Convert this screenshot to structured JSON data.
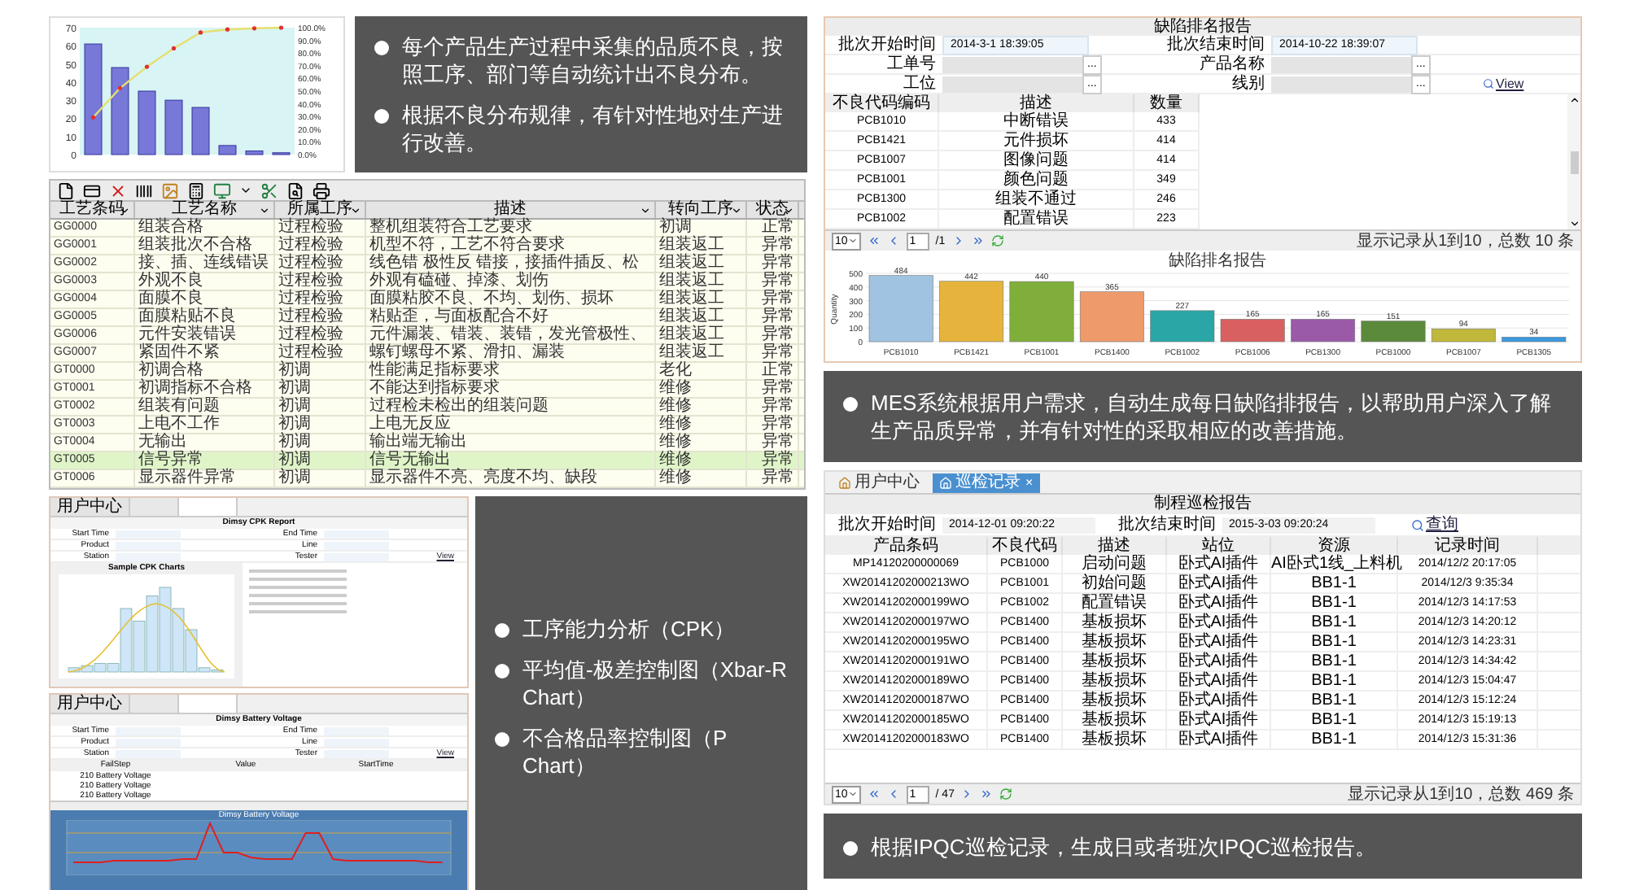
{
  "pareto_chart": {
    "left_axis_labels": [
      "70",
      "60",
      "50",
      "40",
      "30",
      "20",
      "10",
      "0"
    ],
    "right_axis_labels": [
      "100.0%",
      "90.0%",
      "80.0%",
      "70.0%",
      "60.0%",
      "50.0%",
      "40.0%",
      "30.0%",
      "20.0%",
      "10.0%",
      "0.0%"
    ]
  },
  "notes_top_left": [
    "每个产品生产过程中采集的品质不良，按照工序、部门等自动统计出不良分布。",
    "根据不良分布规律，有针对性地对生产进行改善。"
  ],
  "process_table": {
    "columns": [
      "工艺条码",
      "工艺名称",
      "所属工序",
      "描述",
      "转向工序",
      "状态"
    ],
    "rows": [
      {
        "cells": [
          "GG0000",
          "组装合格",
          "过程检验",
          "整机组装符合工艺要求",
          "初调",
          "正常"
        ],
        "selected": false
      },
      {
        "cells": [
          "GG0001",
          "组装批次不合格",
          "过程检验",
          "机型不符，工艺不符合要求",
          "组装返工",
          "异常"
        ],
        "selected": false
      },
      {
        "cells": [
          "GG0002",
          "接、插、连线错误",
          "过程检验",
          "线色错 极性反 错接，接插件插反、松",
          "组装返工",
          "异常"
        ],
        "selected": false
      },
      {
        "cells": [
          "GG0003",
          "外观不良",
          "过程检验",
          "外观有磕碰、掉漆、划伤",
          "组装返工",
          "异常"
        ],
        "selected": false
      },
      {
        "cells": [
          "GG0004",
          "面膜不良",
          "过程检验",
          "面膜粘胶不良、不均、划伤、损坏",
          "组装返工",
          "异常"
        ],
        "selected": false
      },
      {
        "cells": [
          "GG0005",
          "面膜粘贴不良",
          "过程检验",
          "粘贴歪，与面板配合不好",
          "组装返工",
          "异常"
        ],
        "selected": false
      },
      {
        "cells": [
          "GG0006",
          "元件安装错误",
          "过程检验",
          "元件漏装、错装、装错，发光管极性、",
          "组装返工",
          "异常"
        ],
        "selected": false
      },
      {
        "cells": [
          "GG0007",
          "紧固件不紧",
          "过程检验",
          "螺钉螺母不紧、滑扣、漏装",
          "组装返工",
          "异常"
        ],
        "selected": false
      },
      {
        "cells": [
          "GT0000",
          "初调合格",
          "初调",
          "性能满足指标要求",
          "老化",
          "正常"
        ],
        "selected": false
      },
      {
        "cells": [
          "GT0001",
          "初调指标不合格",
          "初调",
          "不能达到指标要求",
          "维修",
          "异常"
        ],
        "selected": false
      },
      {
        "cells": [
          "GT0002",
          "组装有问题",
          "初调",
          "过程检未检出的组装问题",
          "维修",
          "异常"
        ],
        "selected": false
      },
      {
        "cells": [
          "GT0003",
          "上电不工作",
          "初调",
          "上电无反应",
          "维修",
          "异常"
        ],
        "selected": false
      },
      {
        "cells": [
          "GT0004",
          "无输出",
          "初调",
          "输出端无输出",
          "维修",
          "异常"
        ],
        "selected": false
      },
      {
        "cells": [
          "GT0005",
          "信号异常",
          "初调",
          "信号无输出",
          "维修",
          "异常"
        ],
        "selected": true
      },
      {
        "cells": [
          "GT0006",
          "显示器件异常",
          "初调",
          "显示器件不亮、亮度不均、缺段",
          "维修",
          "异常"
        ],
        "selected": false
      }
    ]
  },
  "cpk_window": {
    "tab": "用户中心",
    "title": "Dimsy CPK Report",
    "fields": [
      "Start Time",
      "End Time",
      "Product",
      "Line",
      "Station",
      "Tester"
    ],
    "view_link": "View",
    "chart_title": "Sample CPK Charts"
  },
  "voltage_window": {
    "tab": "用户中心",
    "title": "Dimsy Battery Voltage",
    "fields": [
      "Start Time",
      "End Time",
      "Product",
      "Line",
      "Station",
      "Tester"
    ],
    "view_link": "View",
    "columns": [
      "FailStep",
      "Value",
      "StartTime"
    ],
    "rows": [
      "210 Battery Voltage",
      "210 Battery Voltage",
      "210 Battery Voltage"
    ],
    "chart_title": "Dimsy Battery Voltage"
  },
  "notes_bottom_left": [
    "工序能力分析（CPK）",
    "平均值-极差控制图（Xbar-R Chart）",
    "不合格品率控制图（P Chart）"
  ],
  "defect_report": {
    "title": "缺陷排名报告",
    "fields": [
      {
        "kind": "date",
        "label": "批次开始时间",
        "value": "2014-3-1 18:39:05"
      },
      {
        "kind": "date",
        "label": "批次结束时间",
        "value": "2014-10-22 18:39:07"
      },
      {
        "kind": "picker",
        "label": "工单号",
        "button": "..."
      },
      {
        "kind": "picker",
        "label": "产品名称",
        "button": "..."
      },
      {
        "kind": "picker",
        "label": "工位",
        "button": "..."
      },
      {
        "kind": "picker",
        "label": "线别",
        "button": "..."
      }
    ],
    "view_link": "View",
    "columns": [
      "不良代码编码",
      "描述",
      "数量"
    ],
    "rows": [
      [
        "PCB1010",
        "中断错误",
        "433"
      ],
      [
        "PCB1421",
        "元件损坏",
        "414"
      ],
      [
        "PCB1007",
        "图像问题",
        "414"
      ],
      [
        "PCB1001",
        "颜色问题",
        "349"
      ],
      [
        "PCB1300",
        "组装不通过",
        "246"
      ],
      [
        "PCB1002",
        "配置错误",
        "223"
      ]
    ],
    "pager": {
      "page_size": "10",
      "page": "1",
      "total_pages": "/1",
      "summary": "显示记录从1到10，总数 10 条"
    },
    "chart_data": {
      "type": "bar",
      "title": "缺陷排名报告",
      "ylabel": "Quantity",
      "yticks": [
        0,
        100,
        200,
        300,
        400,
        500
      ],
      "ylim": [
        0,
        500
      ],
      "data_labels": true,
      "categories": [
        "PCB1010",
        "PCB1421",
        "PCB1001",
        "PCB1400",
        "PCB1002",
        "PCB1006",
        "PCB1300",
        "PCB1000",
        "PCB1007",
        "PCB1305"
      ],
      "values": [
        484,
        442,
        440,
        365,
        227,
        165,
        165,
        151,
        94,
        34
      ],
      "grid": true
    }
  },
  "notes_top_right": [
    "MES系统根据用户需求，自动生成每日缺陷排报告，以帮助用户深入了解生产品质异常，并有针对性的采取相应的改善措施。"
  ],
  "ipqc_report": {
    "tabs": [
      {
        "label": "用户中心",
        "selected": false
      },
      {
        "label": "巡检记录",
        "selected": true
      }
    ],
    "close": "×",
    "title": "制程巡检报告",
    "fields": [
      {
        "label": "批次开始时间",
        "value": "2014-12-01 09:20:22"
      },
      {
        "label": "批次结束时间",
        "value": "2015-3-03 09:20:24"
      }
    ],
    "query_button": "查询",
    "columns": [
      "产品条码",
      "不良代码",
      "描述",
      "站位",
      "资源",
      "记录时间"
    ],
    "rows": [
      [
        "MP14120200000069",
        "PCB1000",
        "启动问题",
        "卧式AI插件",
        "AI卧式1线_上料机",
        "2014/12/2 20:17:05"
      ],
      [
        "XW20141202000213WO",
        "PCB1001",
        "初始问题",
        "卧式AI插件",
        "BB1-1",
        "2014/12/3 9:35:34"
      ],
      [
        "XW20141202000199WO",
        "PCB1002",
        "配置错误",
        "卧式AI插件",
        "BB1-1",
        "2014/12/3 14:17:53"
      ],
      [
        "XW20141202000197WO",
        "PCB1400",
        "基板损坏",
        "卧式AI插件",
        "BB1-1",
        "2014/12/3 14:20:12"
      ],
      [
        "XW20141202000195WO",
        "PCB1400",
        "基板损坏",
        "卧式AI插件",
        "BB1-1",
        "2014/12/3 14:23:31"
      ],
      [
        "XW20141202000191WO",
        "PCB1400",
        "基板损坏",
        "卧式AI插件",
        "BB1-1",
        "2014/12/3 14:34:42"
      ],
      [
        "XW20141202000189WO",
        "PCB1400",
        "基板损坏",
        "卧式AI插件",
        "BB1-1",
        "2014/12/3 15:04:47"
      ],
      [
        "XW20141202000187WO",
        "PCB1400",
        "基板损坏",
        "卧式AI插件",
        "BB1-1",
        "2014/12/3 15:12:24"
      ],
      [
        "XW20141202000185WO",
        "PCB1400",
        "基板损坏",
        "卧式AI插件",
        "BB1-1",
        "2014/12/3 15:19:13"
      ],
      [
        "XW20141202000183WO",
        "PCB1400",
        "基板损坏",
        "卧式AI插件",
        "BB1-1",
        "2014/12/3 15:31:36"
      ]
    ],
    "pager": {
      "page_size": "10",
      "page": "1",
      "total_pages": "/ 47",
      "summary": "显示记录从1到10，总数 469 条"
    }
  },
  "notes_bottom_right": [
    "根据IPQC巡检记录，生成日或者班次IPQC巡检报告。"
  ]
}
